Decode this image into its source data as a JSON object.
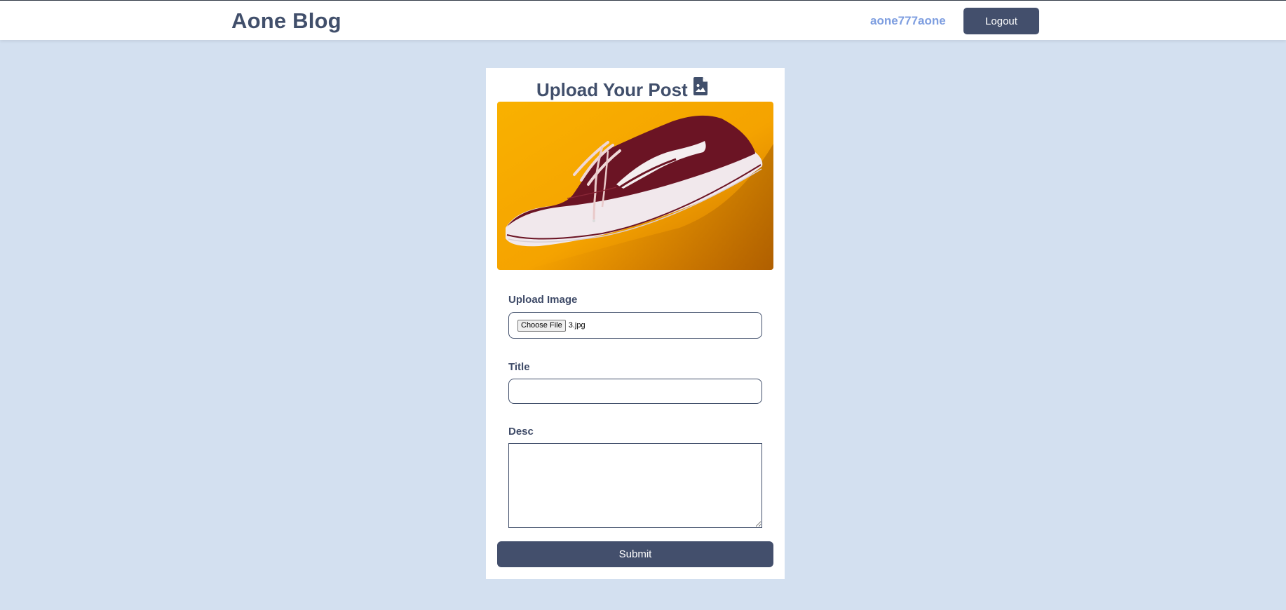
{
  "header": {
    "brand": "Aone Blog",
    "username": "aone777aone",
    "logout_label": "Logout"
  },
  "card": {
    "title": "Upload Your Post",
    "title_icon": "file-image-icon"
  },
  "form": {
    "upload_label": "Upload Image",
    "choose_file_label": "Choose File",
    "file_name": "3.jpg",
    "title_label": "Title",
    "title_value": "",
    "desc_label": "Desc",
    "desc_value": "",
    "submit_label": "Submit"
  },
  "colors": {
    "background": "#d3e0f0",
    "primary": "#434f6c",
    "heading": "#414f6b",
    "username_link": "#7e9ee0",
    "preview_bg": "#f7a600",
    "shoe": "#6b1424"
  }
}
